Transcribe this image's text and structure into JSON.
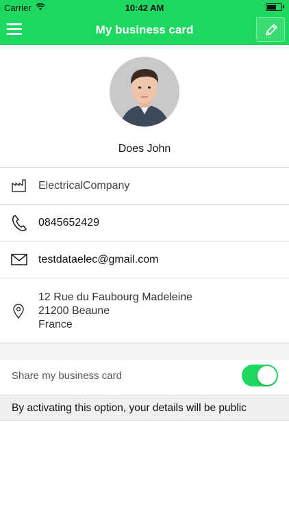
{
  "status_bar": {
    "carrier": "Carrier",
    "time": "10:42 AM"
  },
  "nav": {
    "title": "My business card"
  },
  "profile": {
    "name": "Does John"
  },
  "details": {
    "company": "ElectricalCompany",
    "phone": "0845652429",
    "email": "testdataelec@gmail.com",
    "address": {
      "line1": "12 Rue du Faubourg Madeleine",
      "line2": "21200 Beaune",
      "line3": "France"
    }
  },
  "share": {
    "label": "Share my business card",
    "enabled": true,
    "info": "By activating this option, your details will be public"
  },
  "colors": {
    "accent": "#1ed760"
  },
  "icons": [
    "menu-icon",
    "pencil-icon",
    "factory-icon",
    "phone-icon",
    "mail-icon",
    "location-pin-icon",
    "wifi-icon",
    "battery-icon"
  ]
}
